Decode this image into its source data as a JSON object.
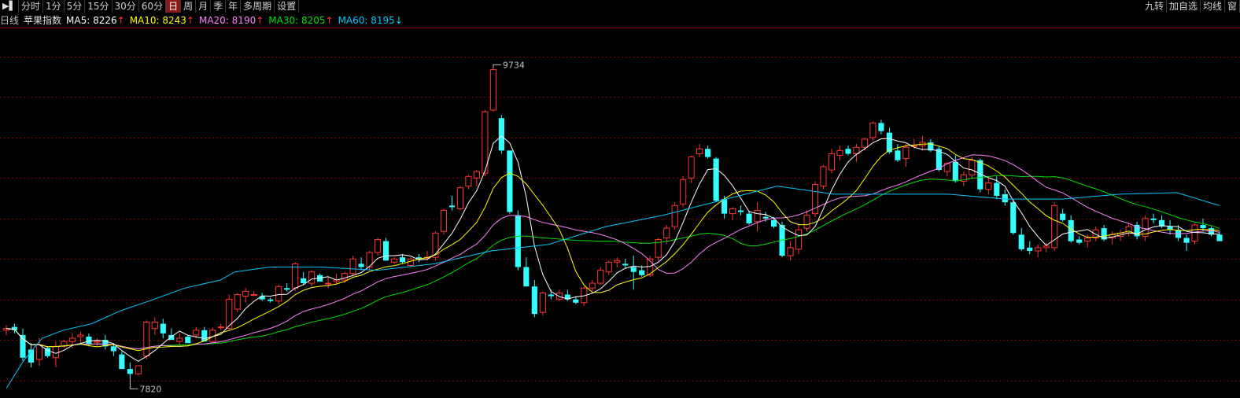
{
  "toolbar": {
    "left": [
      {
        "label": "▶▌",
        "icon": "play-icon"
      },
      {
        "label": "分时"
      },
      {
        "label": "1分"
      },
      {
        "label": "5分"
      },
      {
        "label": "15分"
      },
      {
        "label": "30分"
      },
      {
        "label": "60分"
      },
      {
        "label": "日",
        "active": true
      },
      {
        "label": "周"
      },
      {
        "label": "月"
      },
      {
        "label": "季"
      },
      {
        "label": "年"
      },
      {
        "label": "多周期"
      },
      {
        "label": "设置"
      }
    ],
    "right": [
      {
        "label": "九转"
      },
      {
        "label": "加自选"
      },
      {
        "label": "均线"
      },
      {
        "label": "窗"
      }
    ]
  },
  "info": {
    "period": "日线",
    "name": "苹果指数",
    "ma5": "MA5: 8226",
    "ma5_arrow": "↑",
    "ma10": "MA10: 8243",
    "ma10_arrow": "↑",
    "ma20": "MA20: 8190",
    "ma20_arrow": "↑",
    "ma30": "MA30: 8205",
    "ma30_arrow": "↑",
    "ma60": "MA60: 8195",
    "ma60_arrow": "↓"
  },
  "colors": {
    "up": "#ff3333",
    "down": "#33ffff",
    "ma5": "#ffffff",
    "ma10": "#ffff00",
    "ma20": "#ff80ff",
    "ma30": "#00e000",
    "ma60": "#00c8ff",
    "grid": "#7a0000"
  },
  "chart_data": {
    "type": "candlestick",
    "title": "苹果指数 日线",
    "ylim": [
      7720,
      9975
    ],
    "high_label": "9734",
    "low_label": "7820",
    "ohlc": [
      [
        8110,
        8140,
        8080,
        8120
      ],
      [
        8130,
        8150,
        8090,
        8110
      ],
      [
        8080,
        8120,
        7920,
        7940
      ],
      [
        7990,
        8030,
        7880,
        7910
      ],
      [
        7930,
        8060,
        7890,
        8020
      ],
      [
        8000,
        8010,
        7940,
        7950
      ],
      [
        7940,
        8040,
        7880,
        8010
      ],
      [
        8010,
        8050,
        8000,
        8040
      ],
      [
        8040,
        8090,
        8000,
        8060
      ],
      [
        8070,
        8100,
        8030,
        8080
      ],
      [
        8070,
        8090,
        8010,
        8020
      ],
      [
        8040,
        8060,
        8010,
        8040
      ],
      [
        8050,
        8080,
        7990,
        8010
      ],
      [
        8010,
        8030,
        7950,
        7980
      ],
      [
        7960,
        7980,
        7880,
        7870
      ],
      [
        7870,
        7910,
        7820,
        7840
      ],
      [
        7840,
        7890,
        7830,
        7890
      ],
      [
        7950,
        8170,
        7930,
        8160
      ],
      [
        8120,
        8190,
        8080,
        8160
      ],
      [
        8150,
        8180,
        8060,
        8090
      ],
      [
        8080,
        8120,
        8050,
        8050
      ],
      [
        8040,
        8090,
        8020,
        8060
      ],
      [
        8070,
        8080,
        8030,
        8030
      ],
      [
        8080,
        8130,
        8060,
        8110
      ],
      [
        8110,
        8130,
        8040,
        8040
      ],
      [
        8040,
        8130,
        8040,
        8110
      ],
      [
        8130,
        8150,
        8110,
        8130
      ],
      [
        8120,
        8330,
        8110,
        8300
      ],
      [
        8240,
        8340,
        8220,
        8330
      ],
      [
        8320,
        8370,
        8280,
        8350
      ],
      [
        8330,
        8350,
        8320,
        8330
      ],
      [
        8320,
        8340,
        8290,
        8300
      ],
      [
        8300,
        8310,
        8280,
        8290
      ],
      [
        8290,
        8390,
        8270,
        8380
      ],
      [
        8370,
        8400,
        8350,
        8360
      ],
      [
        8370,
        8530,
        8350,
        8520
      ],
      [
        8430,
        8470,
        8390,
        8400
      ],
      [
        8400,
        8480,
        8380,
        8470
      ],
      [
        8450,
        8460,
        8410,
        8410
      ],
      [
        8400,
        8440,
        8370,
        8400
      ],
      [
        8410,
        8460,
        8390,
        8420
      ],
      [
        8420,
        8470,
        8400,
        8460
      ],
      [
        8460,
        8570,
        8440,
        8550
      ],
      [
        8520,
        8560,
        8480,
        8500
      ],
      [
        8500,
        8600,
        8480,
        8590
      ],
      [
        8590,
        8680,
        8570,
        8670
      ],
      [
        8660,
        8680,
        8540,
        8540
      ],
      [
        8530,
        8560,
        8520,
        8550
      ],
      [
        8560,
        8580,
        8520,
        8530
      ],
      [
        8510,
        8560,
        8500,
        8550
      ],
      [
        8560,
        8580,
        8530,
        8550
      ],
      [
        8560,
        8600,
        8540,
        8560
      ],
      [
        8560,
        8720,
        8540,
        8710
      ],
      [
        8720,
        8860,
        8700,
        8850
      ],
      [
        8880,
        8940,
        8850,
        8870
      ],
      [
        8860,
        9000,
        8850,
        8990
      ],
      [
        9000,
        9070,
        8980,
        9060
      ],
      [
        9050,
        9100,
        9000,
        9090
      ],
      [
        9080,
        9470,
        9060,
        9460
      ],
      [
        9470,
        9730,
        9460,
        9720
      ],
      [
        9420,
        9440,
        9200,
        9220
      ],
      [
        9220,
        8990,
        8830,
        8840
      ],
      [
        8820,
        8850,
        8480,
        8500
      ],
      [
        8500,
        8560,
        8380,
        8380
      ],
      [
        8380,
        8420,
        8190,
        8210
      ],
      [
        8220,
        8350,
        8200,
        8340
      ],
      [
        8330,
        8360,
        8300,
        8320
      ],
      [
        8300,
        8360,
        8290,
        8340
      ],
      [
        8330,
        8360,
        8290,
        8300
      ],
      [
        8300,
        8320,
        8270,
        8280
      ],
      [
        8280,
        8380,
        8260,
        8370
      ],
      [
        8370,
        8420,
        8350,
        8400
      ],
      [
        8400,
        8500,
        8390,
        8480
      ],
      [
        8470,
        8540,
        8450,
        8530
      ],
      [
        8530,
        8560,
        8500,
        8540
      ],
      [
        8520,
        8550,
        8490,
        8510
      ],
      [
        8500,
        8570,
        8360,
        8470
      ],
      [
        8480,
        8510,
        8440,
        8450
      ],
      [
        8450,
        8570,
        8440,
        8550
      ],
      [
        8560,
        8680,
        8540,
        8670
      ],
      [
        8680,
        8760,
        8640,
        8740
      ],
      [
        8750,
        8900,
        8730,
        8880
      ],
      [
        8890,
        9060,
        8870,
        9040
      ],
      [
        9050,
        9190,
        9020,
        9180
      ],
      [
        9200,
        9260,
        9180,
        9230
      ],
      [
        9230,
        9250,
        9170,
        9180
      ],
      [
        9170,
        9180,
        8900,
        8910
      ],
      [
        8920,
        8940,
        8800,
        8830
      ],
      [
        8830,
        8870,
        8790,
        8860
      ],
      [
        8850,
        8880,
        8820,
        8840
      ],
      [
        8830,
        8850,
        8760,
        8770
      ],
      [
        8780,
        8900,
        8720,
        8850
      ],
      [
        8810,
        8840,
        8780,
        8800
      ],
      [
        8790,
        8810,
        8740,
        8750
      ],
      [
        8760,
        8780,
        8560,
        8570
      ],
      [
        8570,
        8660,
        8540,
        8620
      ],
      [
        8610,
        8770,
        8580,
        8730
      ],
      [
        8740,
        8850,
        8720,
        8820
      ],
      [
        8830,
        9030,
        8810,
        9010
      ],
      [
        9000,
        9130,
        8980,
        9120
      ],
      [
        9100,
        9230,
        9080,
        9200
      ],
      [
        9190,
        9250,
        9160,
        9220
      ],
      [
        9230,
        9250,
        9190,
        9200
      ],
      [
        9200,
        9260,
        9150,
        9240
      ],
      [
        9240,
        9300,
        9220,
        9290
      ],
      [
        9300,
        9400,
        9280,
        9390
      ],
      [
        9390,
        9410,
        9320,
        9340
      ],
      [
        9330,
        9360,
        9200,
        9210
      ],
      [
        9220,
        9260,
        9150,
        9160
      ],
      [
        9170,
        9260,
        9120,
        9240
      ],
      [
        9250,
        9290,
        9230,
        9250
      ],
      [
        9250,
        9310,
        9220,
        9270
      ],
      [
        9270,
        9290,
        9210,
        9220
      ],
      [
        9230,
        9250,
        9090,
        9100
      ],
      [
        9090,
        9150,
        9060,
        9140
      ],
      [
        9150,
        9190,
        9020,
        9030
      ],
      [
        9030,
        9090,
        9000,
        9070
      ],
      [
        9070,
        9180,
        9050,
        9160
      ],
      [
        9160,
        9170,
        8960,
        8980
      ],
      [
        8980,
        9050,
        8950,
        9020
      ],
      [
        9020,
        9060,
        8920,
        8940
      ],
      [
        8950,
        8980,
        8880,
        8900
      ],
      [
        8900,
        8920,
        8700,
        8710
      ],
      [
        8700,
        8740,
        8600,
        8610
      ],
      [
        8620,
        8660,
        8580,
        8600
      ],
      [
        8600,
        8640,
        8560,
        8620
      ],
      [
        8620,
        8650,
        8590,
        8630
      ],
      [
        8620,
        8900,
        8600,
        8880
      ],
      [
        8830,
        8860,
        8780,
        8790
      ],
      [
        8790,
        8820,
        8650,
        8660
      ],
      [
        8670,
        8690,
        8640,
        8650
      ],
      [
        8660,
        8700,
        8620,
        8680
      ],
      [
        8680,
        8750,
        8660,
        8730
      ],
      [
        8740,
        8760,
        8660,
        8670
      ],
      [
        8680,
        8720,
        8640,
        8700
      ],
      [
        8690,
        8730,
        8660,
        8710
      ],
      [
        8710,
        8770,
        8690,
        8750
      ],
      [
        8760,
        8780,
        8670,
        8690
      ],
      [
        8690,
        8820,
        8660,
        8800
      ],
      [
        8800,
        8830,
        8770,
        8790
      ],
      [
        8790,
        8820,
        8740,
        8750
      ],
      [
        8750,
        8790,
        8700,
        8730
      ],
      [
        8730,
        8760,
        8660,
        8680
      ],
      [
        8680,
        8700,
        8600,
        8650
      ],
      [
        8660,
        8770,
        8640,
        8760
      ],
      [
        8760,
        8800,
        8720,
        8740
      ],
      [
        8740,
        8750,
        8690,
        8700
      ],
      [
        8700,
        8720,
        8660,
        8660
      ]
    ],
    "ma60": [
      [
        7750,
        0
      ],
      [
        7920,
        12
      ],
      [
        8060,
        25
      ],
      [
        8110,
        40
      ],
      [
        8150,
        60
      ],
      [
        8230,
        80
      ],
      [
        8290,
        100
      ],
      [
        8370,
        125
      ],
      [
        8420,
        150
      ],
      [
        8470,
        160
      ],
      [
        8500,
        185
      ],
      [
        8500,
        220
      ],
      [
        8480,
        260
      ],
      [
        8520,
        300
      ],
      [
        8600,
        340
      ],
      [
        8640,
        380
      ],
      [
        8750,
        420
      ],
      [
        8820,
        460
      ],
      [
        8910,
        500
      ],
      [
        9000,
        540
      ],
      [
        8950,
        580
      ],
      [
        8950,
        620
      ],
      [
        8950,
        660
      ],
      [
        8920,
        700
      ],
      [
        8920,
        740
      ],
      [
        8950,
        780
      ],
      [
        8960,
        820
      ],
      [
        8880,
        850
      ]
    ]
  }
}
